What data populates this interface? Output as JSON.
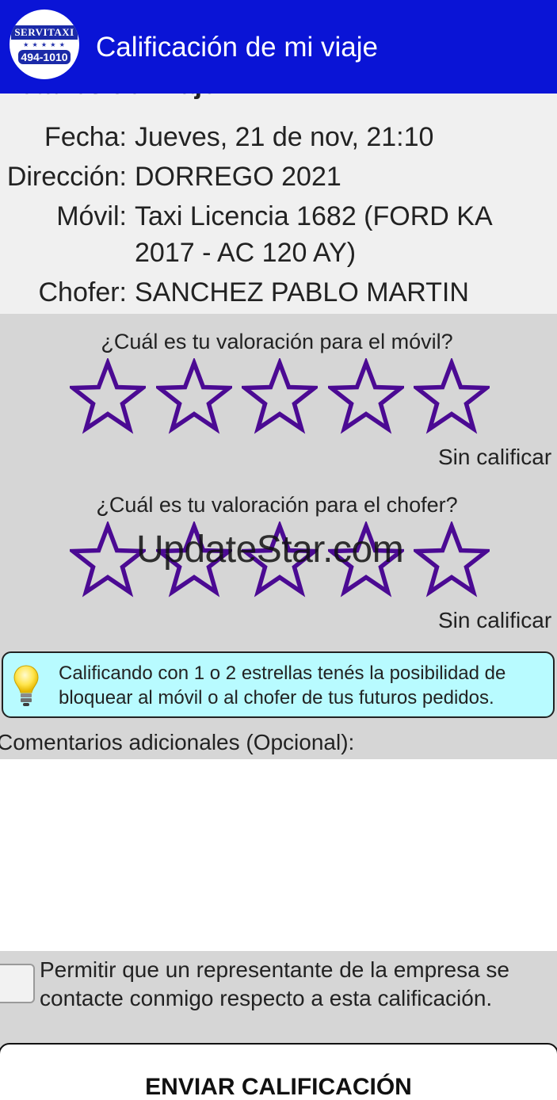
{
  "header": {
    "logo_top": "SERVITAXI",
    "logo_number": "494-1010",
    "title": "Calificación de mi viaje",
    "colors": {
      "appbar": "#0a14d6",
      "star_stroke": "#4b0a93",
      "tip_bg": "#b8fbff"
    }
  },
  "details": {
    "heading": "Detalles del viaje:",
    "rows": [
      {
        "label": "Fecha:",
        "value": "Jueves, 21 de nov, 21:10"
      },
      {
        "label": "Dirección:",
        "value": "DORREGO 2021"
      },
      {
        "label": "Móvil:",
        "value": "Taxi Licencia 1682 (FORD KA 2017 - AC 120 AY)"
      },
      {
        "label": "Chofer:",
        "value": "SANCHEZ PABLO MARTIN"
      }
    ]
  },
  "ratings": {
    "vehicle": {
      "question": "¿Cuál es tu valoración para el móvil?",
      "status": "Sin calificar",
      "value": 0,
      "max": 5
    },
    "driver": {
      "question": "¿Cuál es tu valoración para el chofer?",
      "status": "Sin calificar",
      "value": 0,
      "max": 5
    }
  },
  "watermark": "UpdateStar.com",
  "tip": {
    "icon": "lightbulb-icon",
    "text": "Calificando con 1 o 2 estrellas tenés la posibilidad de bloquear al móvil o al chofer de tus futuros pedidos."
  },
  "comments": {
    "label": "Comentarios adicionales (Opcional):",
    "value": ""
  },
  "consent": {
    "checked": false,
    "text": "Permitir que un representante de la empresa se contacte conmigo respecto a esta calificación."
  },
  "submit": {
    "label": "ENVIAR CALIFICACIÓN"
  }
}
